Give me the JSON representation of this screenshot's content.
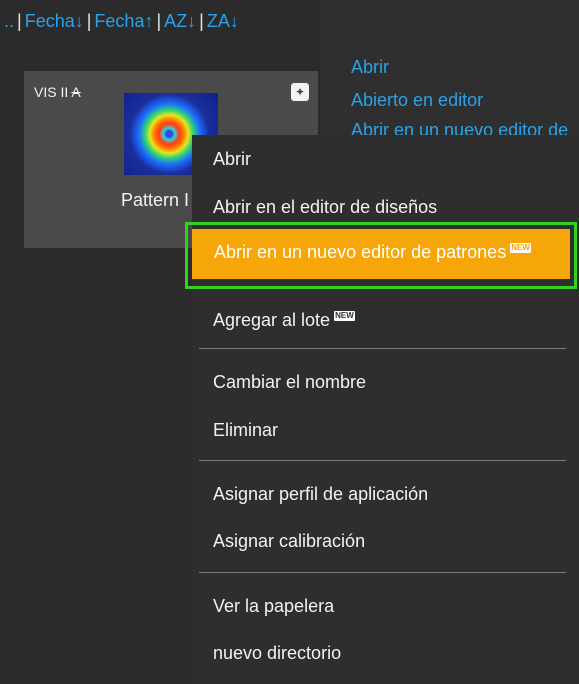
{
  "sort_bar": {
    "prefix": "..",
    "items": [
      "Fecha↓",
      "Fecha↑",
      "AZ↓",
      "ZA↓"
    ]
  },
  "card": {
    "title": "VIS II",
    "title_suffix": "A",
    "label": "Pattern I"
  },
  "side_panel": {
    "links": [
      "Abrir",
      "Abierto en editor",
      "Abrir en un nuevo editor de"
    ]
  },
  "context_menu": {
    "open": "Abrir",
    "open_layout_editor": "Abrir en el editor de diseños",
    "open_new_pattern_editor": "Abrir en un nuevo editor de patrones",
    "add_to_batch": "Agregar al lote",
    "rename": "Cambiar el nombre",
    "delete": "Eliminar",
    "assign_app_profile": "Asignar perfil de aplicación",
    "assign_calibration": "Asignar calibración",
    "view_trash": "Ver la papelera",
    "new_directory": "nuevo directorio",
    "new_badge": "NEW"
  },
  "colors": {
    "accent_link": "#2aa3e8",
    "highlight": "#f6a609",
    "highlight_outline": "#31d11f"
  }
}
